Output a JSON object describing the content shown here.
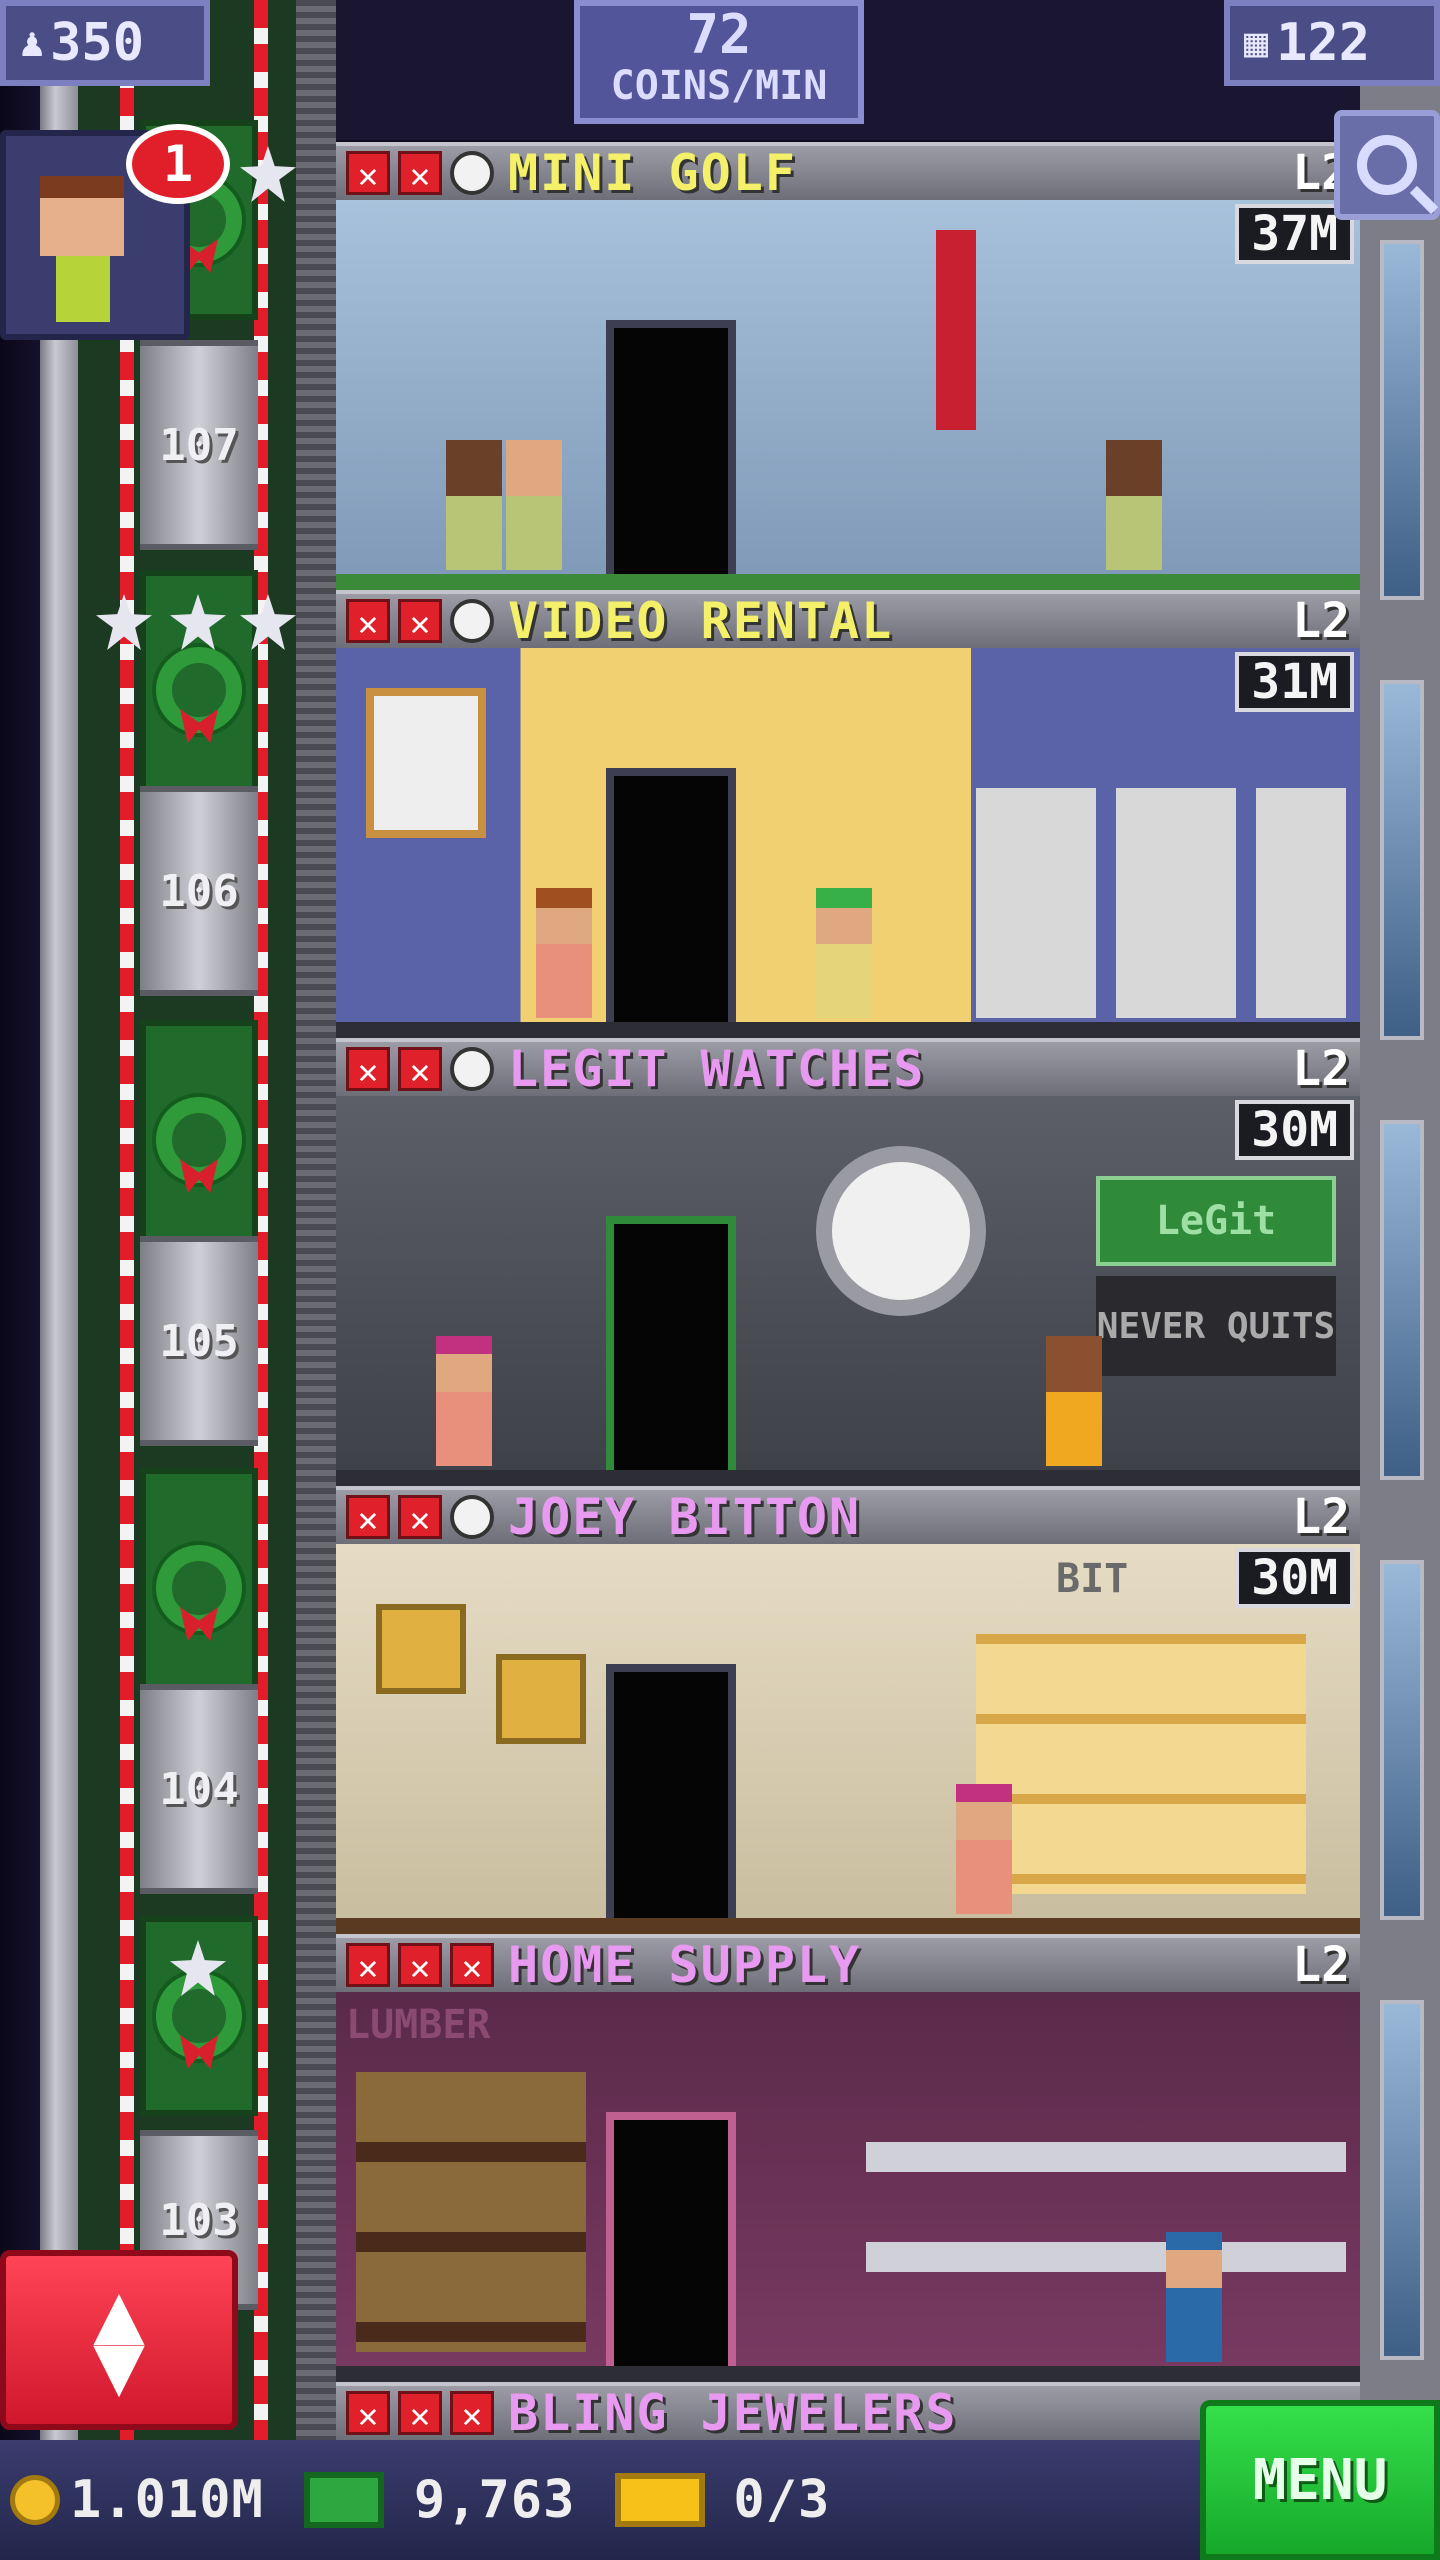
{
  "top_bar": {
    "population": "350",
    "coins_per_min_value": "72",
    "coins_per_min_label": "COINS/MIN",
    "floors_count": "122"
  },
  "resident": {
    "notification_count": "1"
  },
  "floors": [
    {
      "name": "MINI GOLF",
      "level": "L2",
      "timer": "37M",
      "name_color": "#f4f06a",
      "marks": [
        "x",
        "x",
        "clock"
      ]
    },
    {
      "name": "VIDEO RENTAL",
      "level": "L2",
      "timer": "31M",
      "name_color": "#f4f06a",
      "marks": [
        "x",
        "x",
        "clock"
      ]
    },
    {
      "name": "LEGIT WATCHES",
      "level": "L2",
      "timer": "30M",
      "name_color": "#e89af0",
      "marks": [
        "x",
        "x",
        "clock"
      ]
    },
    {
      "name": "JOEY BITTON",
      "level": "L2",
      "timer": "30M",
      "name_color": "#e89af0",
      "marks": [
        "x",
        "x",
        "clock"
      ]
    },
    {
      "name": "HOME SUPPLY",
      "level": "L2",
      "timer": "",
      "name_color": "#e89af0",
      "marks": [
        "x",
        "x",
        "x"
      ]
    },
    {
      "name": "BLING JEWELERS",
      "level": "",
      "timer": "",
      "name_color": "#e89af0",
      "marks": [
        "x",
        "x",
        "x"
      ]
    }
  ],
  "elevator_floors": [
    "107",
    "106",
    "105",
    "104",
    "103"
  ],
  "shop_signs": {
    "legit": "LeGit",
    "never_quits": "NEVER QUITS",
    "lumber": "LUMBER",
    "bit": "BIT"
  },
  "bottom_bar": {
    "coins": "1.010M",
    "bux": "9,763",
    "tickets": "0/3",
    "menu_label": "MENU"
  },
  "colors": {
    "menu_green": "#22c838",
    "elevator_red": "#e8203a",
    "name_yellow": "#f4f06a",
    "name_pink": "#e89af0"
  }
}
